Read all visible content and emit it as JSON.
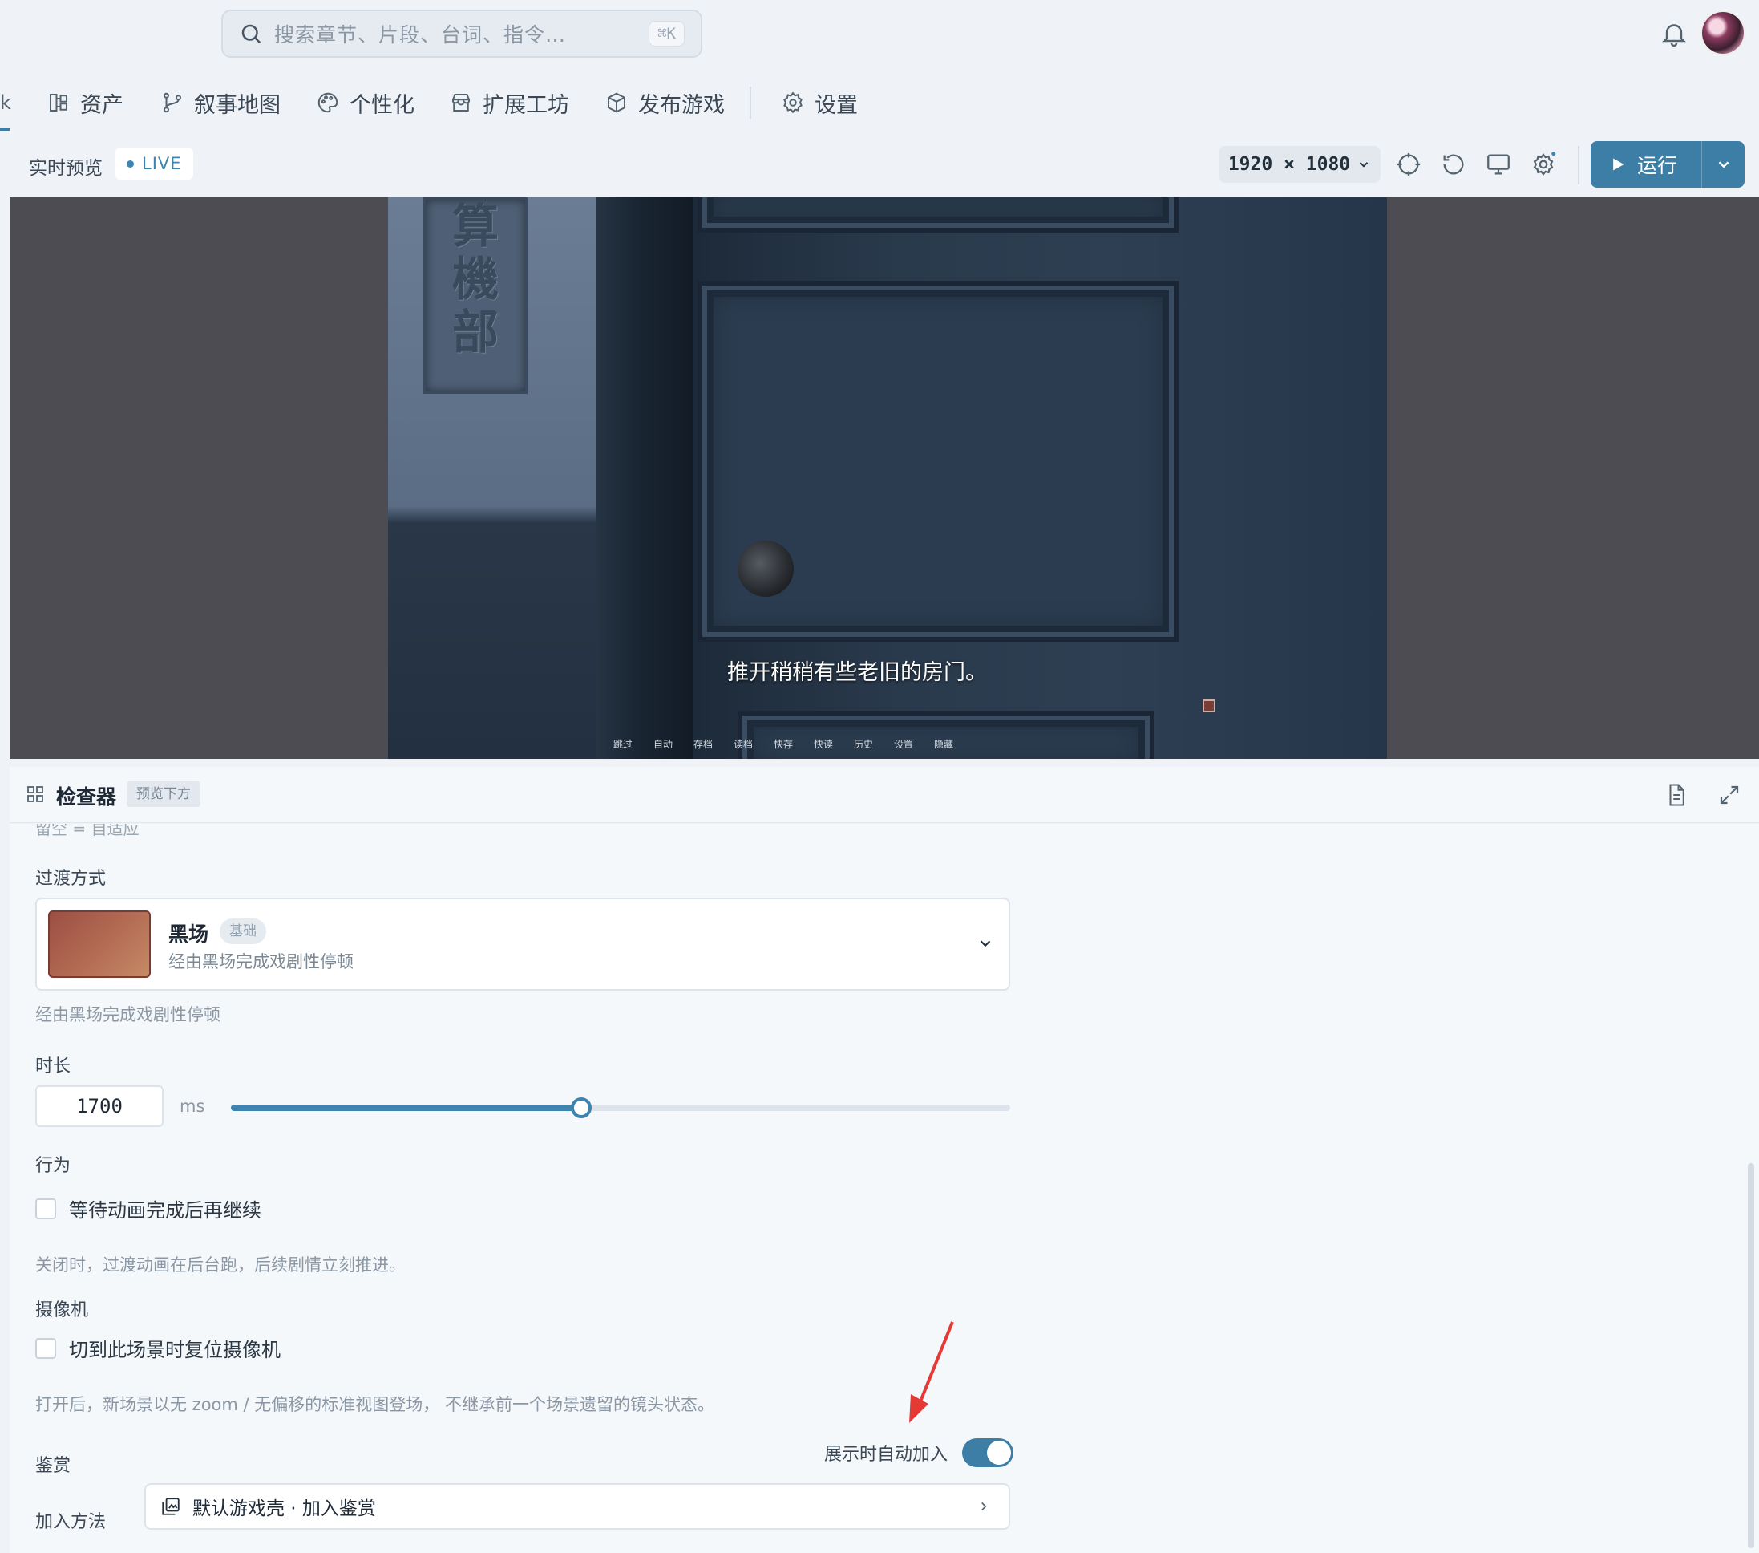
{
  "search": {
    "placeholder": "搜索章节、片段、台词、指令…",
    "shortcut": "⌘K"
  },
  "nav": {
    "edge_label": "k",
    "items": [
      {
        "label": "资产",
        "icon": "assets-icon"
      },
      {
        "label": "叙事地图",
        "icon": "branch-icon"
      },
      {
        "label": "个性化",
        "icon": "palette-icon"
      },
      {
        "label": "扩展工坊",
        "icon": "store-icon"
      },
      {
        "label": "发布游戏",
        "icon": "package-icon"
      },
      {
        "label": "设置",
        "icon": "gear-icon"
      }
    ]
  },
  "preview": {
    "title": "实时预览",
    "live_label": "LIVE",
    "resolution": "1920 × 1080",
    "run_label": "运行"
  },
  "scene": {
    "sign_chars": [
      "算",
      "機",
      "部"
    ],
    "subtitle": "推开稍稍有些老旧的房门。",
    "game_bar": [
      "跳过",
      "自动",
      "存档",
      "读档",
      "快存",
      "快读",
      "历史",
      "设置",
      "隐藏"
    ]
  },
  "inspector": {
    "title": "检查器",
    "tag": "预览下方",
    "cut_text": "留空 = 自适应",
    "transition": {
      "section_label": "过渡方式",
      "name": "黑场",
      "badge": "基础",
      "desc": "经由黑场完成戏剧性停顿",
      "hint": "经由黑场完成戏剧性停顿"
    },
    "duration": {
      "label": "时长",
      "value": "1700",
      "unit": "ms",
      "slider_fraction": 0.45
    },
    "behavior": {
      "label": "行为",
      "checkbox_label": "等待动画完成后再继续",
      "checked": false,
      "hint": "关闭时，过渡动画在后台跑，后续剧情立刻推进。"
    },
    "camera": {
      "label": "摄像机",
      "checkbox_label": "切到此场景时复位摄像机",
      "checked": false,
      "hint": "打开后，新场景以无 zoom / 无偏移的标准视图登场， 不继承前一个场景遗留的镜头状态。"
    },
    "gallery": {
      "label": "鉴赏",
      "toggle_label": "展示时自动加入",
      "toggle_on": true,
      "method_label": "加入方法",
      "method_value": "默认游戏壳 · 加入鉴赏"
    }
  },
  "colors": {
    "accent": "#3d7ea6",
    "live": "#3d85b0",
    "annotation_arrow": "#e53935"
  }
}
